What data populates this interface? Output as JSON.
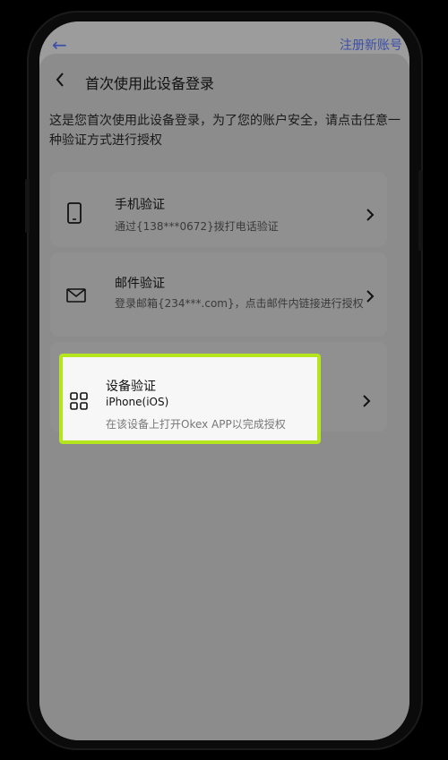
{
  "underlay": {
    "register_label": "注册新账号"
  },
  "header": {
    "title": "首次使用此设备登录"
  },
  "intro": {
    "text": "这是您首次使用此设备登录，为了您的账户安全，请点击任意一种验证方式进行授权"
  },
  "methods": [
    {
      "name": "手机验证",
      "desc": "通过{138***0672}拨打电话验证",
      "icon": "phone-icon"
    },
    {
      "name": "邮件验证",
      "desc": "登录邮箱{234***.com}，点击邮件内链接进行授权",
      "icon": "mail-icon"
    },
    {
      "name": "设备验证",
      "sub": "iPhone(iOS)",
      "desc": "在该设备上打开Okex APP以完成授权",
      "icon": "device-grid-icon"
    }
  ],
  "colors": {
    "highlight_border": "#b5e61d",
    "accent_blue": "#3b4fa8"
  }
}
